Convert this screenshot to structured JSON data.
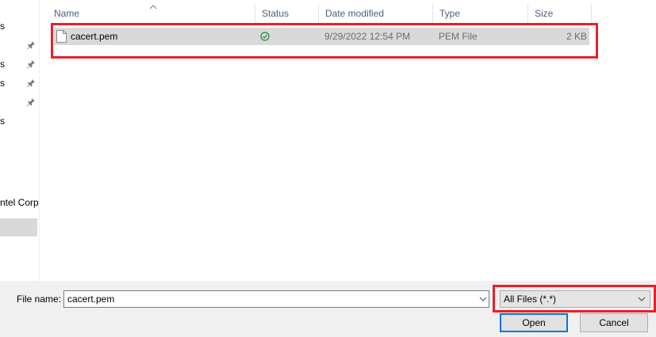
{
  "nav": {
    "items": [
      {
        "label": "s",
        "pinned": false
      },
      {
        "label": "",
        "pinned": true
      },
      {
        "label": "s",
        "pinned": true
      },
      {
        "label": "s",
        "pinned": true
      },
      {
        "label": "",
        "pinned": true
      },
      {
        "label": "s",
        "pinned": false
      },
      {
        "label": "ntel Corp",
        "pinned": false
      },
      {
        "label": "",
        "pinned": false,
        "selected": true
      }
    ]
  },
  "columns": {
    "name": "Name",
    "status": "Status",
    "date_modified": "Date modified",
    "type": "Type",
    "size": "Size",
    "sorted_by": "Name",
    "sort_direction": "ascending"
  },
  "files": [
    {
      "name": "cacert.pem",
      "status_icon": "sync-ok-icon",
      "date_modified": "9/29/2022 12:54 PM",
      "type": "PEM File",
      "size": "2 KB",
      "selected": true,
      "icon": "file-icon"
    }
  ],
  "footer": {
    "file_name_label": "File name:",
    "file_name_value": "cacert.pem",
    "file_type_filter": "All Files (*.*)",
    "open_label": "Open",
    "cancel_label": "Cancel"
  },
  "colors": {
    "highlight_annotation": "#e8202b",
    "selection": "#d9d9d9",
    "header_text": "#4c607a",
    "status_ok": "#1e8c3a",
    "primary_button_border": "#0078d7"
  }
}
